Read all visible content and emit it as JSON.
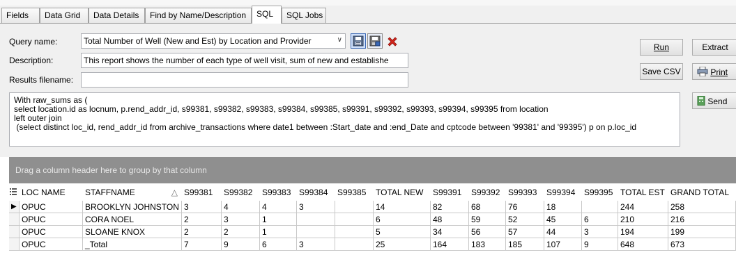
{
  "tabs": [
    {
      "label": "Fields"
    },
    {
      "label": "Data Grid"
    },
    {
      "label": "Data Details"
    },
    {
      "label": "Find by Name/Description"
    },
    {
      "label": "SQL",
      "active": true
    },
    {
      "label": "SQL Jobs"
    }
  ],
  "query": {
    "name_label": "Query name:",
    "name_value": "Total Number of Well (New and Est) by Location and Provider",
    "description_label": "Description:",
    "description_value": "This report shows the number of each type of well visit, sum of new and establishe",
    "results_label": "Results filename:",
    "results_value": ""
  },
  "buttons": {
    "run": "Run",
    "extract": "Extract",
    "save_csv": "Save CSV",
    "print": "Print",
    "send": "Send"
  },
  "sql_text": "With raw_sums as (\nselect location.id as locnum, p.rend_addr_id, s99381, s99382, s99383, s99384, s99385, s99391, s99392, s99393, s99394, s99395 from location\nleft outer join\n (select distinct loc_id, rend_addr_id from archive_transactions where date1 between :Start_date and :end_Date and cptcode between '99381' and '99395') p on p.loc_id",
  "grid": {
    "group_hint": "Drag a column header here to group by that column",
    "columns": [
      "LOC NAME",
      "STAFFNAME",
      "S99381",
      "S99382",
      "S99383",
      "S99384",
      "S99385",
      "TOTAL NEW",
      "S99391",
      "S99392",
      "S99393",
      "S99394",
      "S99395",
      "TOTAL EST",
      "GRAND TOTAL"
    ],
    "sort_indicator": "△",
    "row_indicator": "▶",
    "rows": [
      [
        "OPUC",
        "BROOKLYN JOHNSTON",
        "3",
        "4",
        "4",
        "3",
        "",
        "14",
        "82",
        "68",
        "76",
        "18",
        "",
        "244",
        "258"
      ],
      [
        "OPUC",
        "CORA NOEL",
        "2",
        "3",
        "1",
        "",
        "",
        "6",
        "48",
        "59",
        "52",
        "45",
        "6",
        "210",
        "216"
      ],
      [
        "OPUC",
        "SLOANE KNOX",
        "2",
        "2",
        "1",
        "",
        "",
        "5",
        "34",
        "56",
        "57",
        "44",
        "3",
        "194",
        "199"
      ],
      [
        "OPUC",
        "_Total",
        "7",
        "9",
        "6",
        "3",
        "",
        "25",
        "164",
        "183",
        "185",
        "107",
        "9",
        "648",
        "673"
      ]
    ]
  },
  "icons": {
    "save": "save-icon",
    "save_as": "save-as-icon",
    "delete": "delete-icon",
    "printer": "printer-icon",
    "send": "send-icon",
    "column_chooser": "column-chooser-icon"
  },
  "colors": {
    "group_bar": "#8f8f8f",
    "delete_red": "#d4261c",
    "selected_icon_bg": "#cfe0fb"
  }
}
